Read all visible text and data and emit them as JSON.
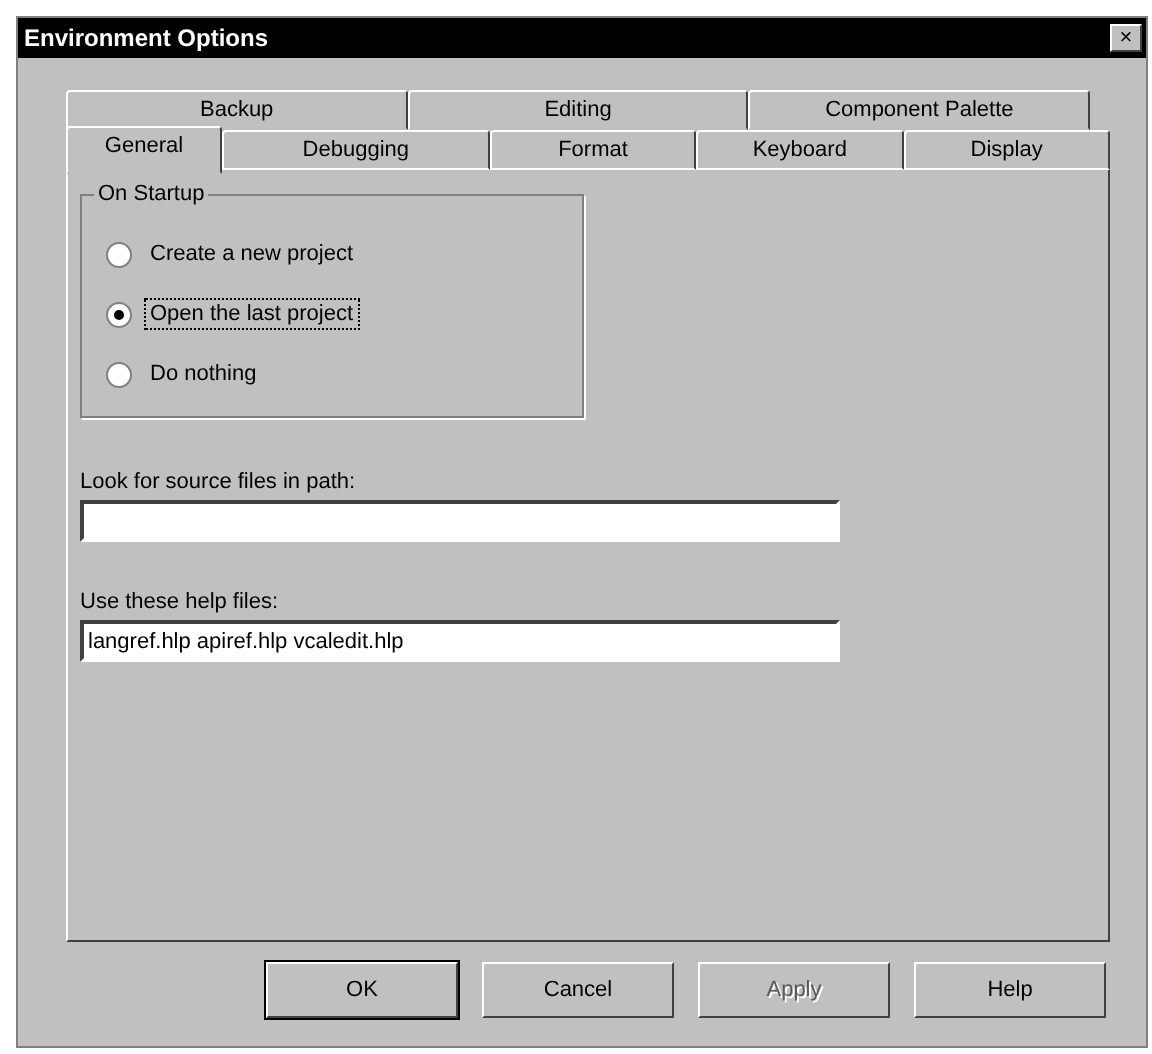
{
  "window": {
    "title": "Environment Options",
    "close": "×"
  },
  "tab_rows": [
    [
      {
        "label": "Backup",
        "selected": false
      },
      {
        "label": "Editing",
        "selected": false
      },
      {
        "label": "Component Palette",
        "selected": false
      }
    ],
    [
      {
        "label": "General",
        "selected": true
      },
      {
        "label": "Debugging",
        "selected": false
      },
      {
        "label": "Format",
        "selected": false
      },
      {
        "label": "Keyboard",
        "selected": false
      },
      {
        "label": "Display",
        "selected": false
      }
    ]
  ],
  "on_startup": {
    "title": "On Startup",
    "options": [
      {
        "label": "Create a new project",
        "selected": false,
        "focused": false
      },
      {
        "label": "Open the last project",
        "selected": true,
        "focused": true
      },
      {
        "label": "Do nothing",
        "selected": false,
        "focused": false
      }
    ]
  },
  "fields": [
    {
      "label": "Look for source files in path:"
    },
    {
      "label": "Use these help files:",
      "value": "langref.hlp apiref.hlp vcaledit.hlp"
    }
  ],
  "buttons": [
    {
      "label": "OK",
      "default": true,
      "disabled": false
    },
    {
      "label": "Cancel",
      "default": false,
      "disabled": false
    },
    {
      "label": "Apply",
      "default": false,
      "disabled": true
    },
    {
      "label": "Help",
      "default": false,
      "disabled": false
    }
  ]
}
